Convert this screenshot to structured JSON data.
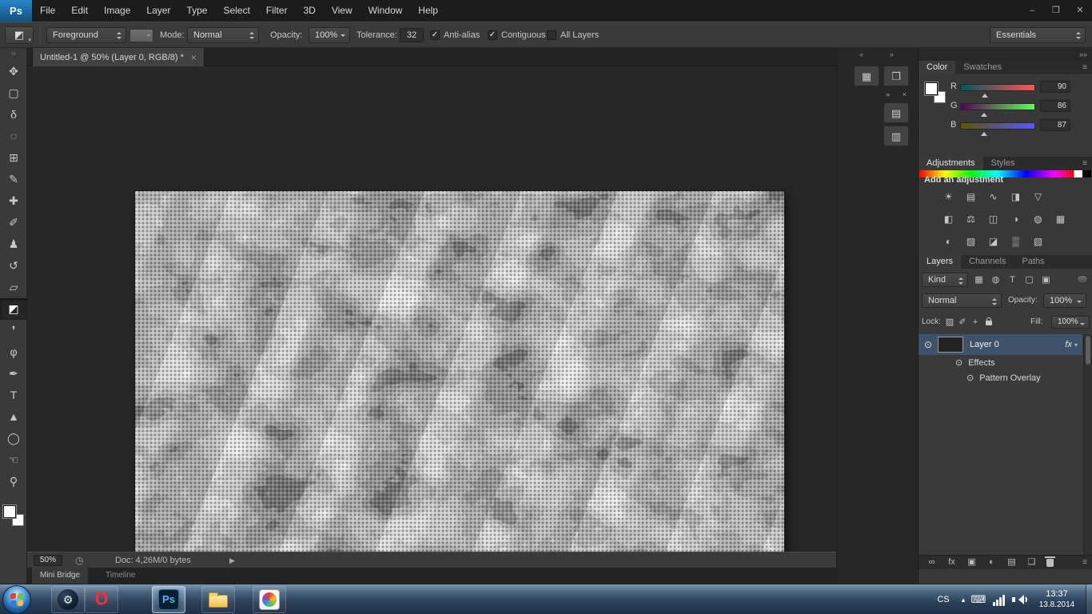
{
  "menubar": {
    "logo": "Ps",
    "menus": [
      {
        "name": "menu-file",
        "label": "File"
      },
      {
        "name": "menu-edit",
        "label": "Edit"
      },
      {
        "name": "menu-image",
        "label": "Image"
      },
      {
        "name": "menu-layer",
        "label": "Layer"
      },
      {
        "name": "menu-type",
        "label": "Type"
      },
      {
        "name": "menu-select",
        "label": "Select"
      },
      {
        "name": "menu-filter",
        "label": "Filter"
      },
      {
        "name": "menu-3d",
        "label": "3D"
      },
      {
        "name": "menu-view",
        "label": "View"
      },
      {
        "name": "menu-window",
        "label": "Window"
      },
      {
        "name": "menu-help",
        "label": "Help"
      }
    ],
    "window_controls": {
      "minimize": "–",
      "restore": "❐",
      "close": "✕"
    }
  },
  "options_bar": {
    "tool_icon": "◩",
    "fill_source": "Foreground",
    "mode_label": "Mode:",
    "mode_value": "Normal",
    "opacity_label": "Opacity:",
    "opacity_value": "100%",
    "tolerance_label": "Tolerance:",
    "tolerance_value": "32",
    "anti_alias": {
      "label": "Anti-alias",
      "check": "✓"
    },
    "contiguous": {
      "label": "Contiguous",
      "check": "✓"
    },
    "all_layers": {
      "label": "All Layers",
      "check": ""
    },
    "workspace": "Essentials"
  },
  "toolbar": {
    "toggle_glyph": "››",
    "tools": [
      {
        "name": "move-tool",
        "glyph": "✥"
      },
      {
        "name": "rectangular-marquee-tool",
        "glyph": "▢"
      },
      {
        "name": "lasso-tool",
        "glyph": "δ"
      },
      {
        "name": "quick-selection-tool",
        "glyph": "◌"
      },
      {
        "name": "crop-tool",
        "glyph": "⊞"
      },
      {
        "name": "eyedropper-tool",
        "glyph": "✎"
      },
      {
        "name": "healing-brush-tool",
        "glyph": "✚"
      },
      {
        "name": "brush-tool",
        "glyph": "✐"
      },
      {
        "name": "clone-stamp-tool",
        "glyph": "♟"
      },
      {
        "name": "history-brush-tool",
        "glyph": "↺"
      },
      {
        "name": "eraser-tool",
        "glyph": "▱"
      },
      {
        "name": "paint-bucket-tool",
        "glyph": "◩",
        "active": true
      },
      {
        "name": "blur-tool",
        "glyph": "❜"
      },
      {
        "name": "dodge-tool",
        "glyph": "φ"
      },
      {
        "name": "pen-tool",
        "glyph": "✒"
      },
      {
        "name": "type-tool",
        "glyph": "T"
      },
      {
        "name": "path-selection-tool",
        "glyph": "▲"
      },
      {
        "name": "ellipse-tool",
        "glyph": "◯"
      },
      {
        "name": "hand-tool",
        "glyph": "☜"
      },
      {
        "name": "zoom-tool",
        "glyph": "⚲"
      }
    ]
  },
  "document": {
    "tab_title": "Untitled-1 @ 50% (Layer 0, RGB/8) *",
    "close_glyph": "×"
  },
  "status_bar": {
    "zoom": "50%",
    "status_icon": "◷",
    "doc_info": "Doc: 4,26M/0 bytes",
    "menu_arrow": "▶"
  },
  "bottom_tabs": {
    "mini_bridge": "Mini Bridge",
    "timeline": "Timeline"
  },
  "side_strips": {
    "collapse_left": "«",
    "collapse_right": "»",
    "histogram_glyph": "▦",
    "cube_glyph": "❒",
    "close_glyph": "×",
    "graph_glyph": "▤",
    "props_glyph": "▥"
  },
  "dock": {
    "collapse_glyph": "»»",
    "panel_menu_glyph": "≡"
  },
  "panels": {
    "color": {
      "tab_color": "Color",
      "tab_swatches": "Swatches",
      "channels": [
        {
          "label": "R",
          "value": "90"
        },
        {
          "label": "G",
          "value": "86"
        },
        {
          "label": "B",
          "value": "87"
        }
      ]
    },
    "adjustments": {
      "tab_adjustments": "Adjustments",
      "tab_styles": "Styles",
      "title": "Add an adjustment",
      "icons_row1": [
        {
          "name": "brightness-contrast-icon",
          "glyph": "☀"
        },
        {
          "name": "levels-icon",
          "glyph": "▤"
        },
        {
          "name": "curves-icon",
          "glyph": "∿"
        },
        {
          "name": "exposure-icon",
          "glyph": "◨"
        },
        {
          "name": "vibrance-icon",
          "glyph": "▽"
        }
      ],
      "icons_row2": [
        {
          "name": "hue-saturation-icon",
          "glyph": "◧"
        },
        {
          "name": "color-balance-icon",
          "glyph": "⚖"
        },
        {
          "name": "black-white-icon",
          "glyph": "◫"
        },
        {
          "name": "photo-filter-icon",
          "glyph": "◑"
        },
        {
          "name": "channel-mixer-icon",
          "glyph": "◍"
        },
        {
          "name": "color-lookup-icon",
          "glyph": "▦"
        }
      ],
      "icons_row3": [
        {
          "name": "invert-icon",
          "glyph": "◐"
        },
        {
          "name": "posterize-icon",
          "glyph": "▨"
        },
        {
          "name": "threshold-icon",
          "glyph": "◪"
        },
        {
          "name": "gradient-map-icon",
          "glyph": "▒"
        },
        {
          "name": "selective-color-icon",
          "glyph": "▧"
        }
      ]
    },
    "layers": {
      "tab_layers": "Layers",
      "tab_channels": "Channels",
      "tab_paths": "Paths",
      "kind": "Kind",
      "filter_icons": [
        {
          "name": "filter-pixel-layers-icon",
          "glyph": "▦"
        },
        {
          "name": "filter-adjustment-layers-icon",
          "glyph": "◍"
        },
        {
          "name": "filter-type-layers-icon",
          "glyph": "T"
        },
        {
          "name": "filter-shape-layers-icon",
          "glyph": "▢"
        },
        {
          "name": "filter-smart-objects-icon",
          "glyph": "▣"
        }
      ],
      "blend_mode": "Normal",
      "opacity_label": "Opacity:",
      "opacity_value": "100%",
      "lock_label": "Lock:",
      "lock_icons": [
        {
          "name": "lock-transparent-icon",
          "glyph": "▨"
        },
        {
          "name": "lock-pixels-icon",
          "glyph": "✐"
        },
        {
          "name": "lock-position-icon",
          "glyph": "+"
        }
      ],
      "fill_label": "Fill:",
      "fill_value": "100%",
      "eye_glyph": "⊙",
      "layer0": {
        "name": "Layer 0",
        "fx": "fx",
        "fx_arrow": "▾"
      },
      "effects": "Effects",
      "pattern_overlay": "Pattern Overlay",
      "bottom_icons": [
        {
          "name": "link-layers-icon",
          "glyph": "∞"
        },
        {
          "name": "layer-style-icon",
          "glyph": "fx"
        },
        {
          "name": "layer-mask-icon",
          "glyph": "▣"
        },
        {
          "name": "adjustment-layer-icon",
          "glyph": "◐"
        },
        {
          "name": "layer-group-icon",
          "glyph": "▤"
        },
        {
          "name": "new-layer-icon",
          "glyph": "❏"
        }
      ]
    }
  },
  "taskbar": {
    "steam_glyph": "⚙",
    "opera_glyph": "O",
    "ps_glyph": "Ps",
    "tray": {
      "lang": "CS",
      "chevron": "▴",
      "keyboard": "⌨",
      "time": "13:37",
      "date": "13.8.2014"
    }
  }
}
